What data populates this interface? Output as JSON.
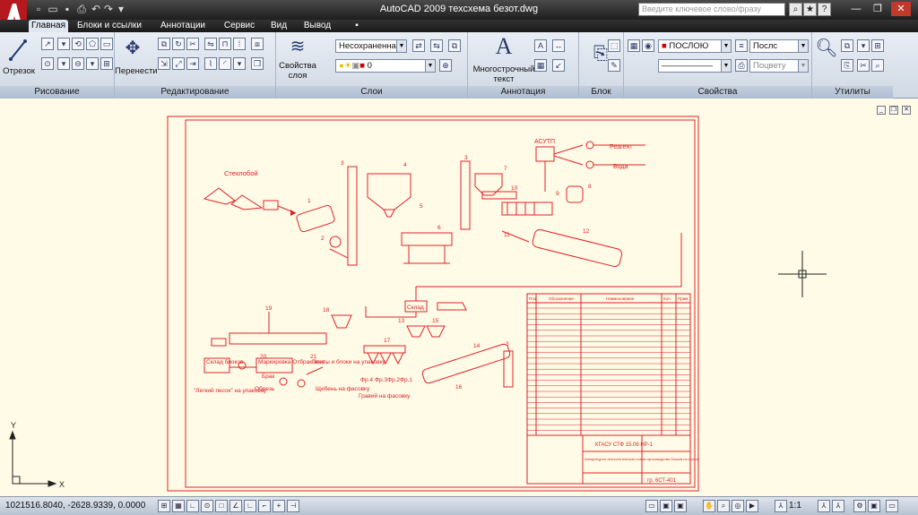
{
  "app": {
    "title": "AutoCAD 2009  техсхема безот.dwg",
    "logo_letter": "A"
  },
  "quick_access": [
    "new-icon",
    "open-icon",
    "save-icon",
    "print-icon",
    "undo-icon",
    "redo-icon",
    "dropdown-icon"
  ],
  "search": {
    "placeholder": "Введите ключевое слово/фразу"
  },
  "window_controls": [
    "minimize",
    "maximize",
    "close"
  ],
  "tabs": [
    {
      "label": "Главная",
      "active": true
    },
    {
      "label": "Блоки и ссылки"
    },
    {
      "label": "Аннотации"
    },
    {
      "label": "Сервис"
    },
    {
      "label": "Вид"
    },
    {
      "label": "Вывод"
    },
    {
      "label": "▪"
    }
  ],
  "ribbon": {
    "draw": {
      "title": "Рисование",
      "line_label": "Отрезок"
    },
    "modify": {
      "title": "Редактирование",
      "move_label": "Перенести"
    },
    "layers": {
      "title": "Слои",
      "props_label": "Свойства слоя",
      "state_value": "Несохраненна",
      "layer_value": "0"
    },
    "annotation": {
      "title": "Аннотация",
      "mtext_label": "Многострочный текст",
      "mtext_glyph": "A"
    },
    "block": {
      "title": "Блок"
    },
    "properties": {
      "title": "Свойства",
      "color_value": "ПОСЛОЮ",
      "linetype_value": "Послс",
      "lineweight_value": "——————",
      "plot_value": "Поцвету"
    },
    "utilities": {
      "title": "Утилиты"
    }
  },
  "drawing": {
    "labels": {
      "steklo": "Стеклобой",
      "asutp": "АСУТП",
      "reagent": "Реагент",
      "voda": "Вода",
      "sklad": "Склад",
      "sklad_blokov": "Склад блоков",
      "markirovka": "Маркировка Отбраковка",
      "brak": "Брак",
      "obrezi": "Обрезь",
      "plity": "Плиты и блоки на упаковку",
      "legkiy": "\"Легкий песок\" на упаковку",
      "shcheben": "Щебень на фасовку",
      "fr4": "Фр.4",
      "fr3": "Фр.3",
      "fr2": "Фр.2",
      "fr1": "Фр.1",
      "gravii": "Гравий на фасовку",
      "stamp_code": "КГАСУ  СТФ 15.06 НР-1",
      "stamp_sheet": "гр. 6СТ-401",
      "stamp_desc": "Аппаратурно-технологическая схема производства блоков из стекла"
    },
    "numbers": [
      "1",
      "2",
      "3",
      "4",
      "5",
      "6",
      "7",
      "8",
      "9",
      "10",
      "11",
      "12",
      "13",
      "14",
      "15",
      "16",
      "17",
      "18",
      "19",
      "20",
      "21"
    ],
    "table_headers": [
      "Поз.",
      "Обозначение",
      "Наименование",
      "Кол.",
      "Прим."
    ]
  },
  "status": {
    "coords": "1021516.8040, -2628.9339, 0.0000",
    "scale": "1:1"
  },
  "ucs": {
    "x": "X",
    "y": "Y"
  },
  "colors": {
    "drawing_line": "#e0202a",
    "background": "#fffbe6",
    "titlebar": "#2a2a2a"
  }
}
